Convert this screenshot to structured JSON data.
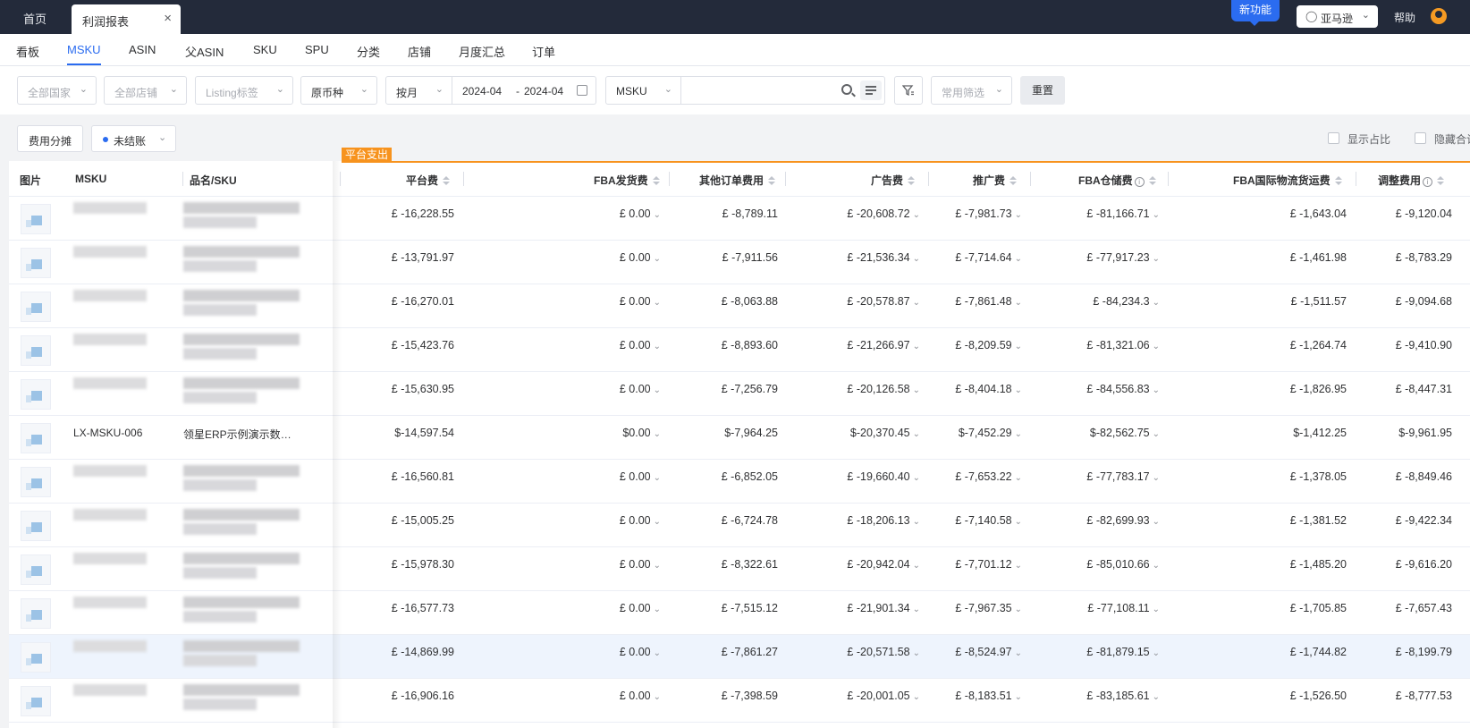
{
  "topbar": {
    "home_tab": "首页",
    "active_tab": "利润报表",
    "close_symbol": "×",
    "new_feature": "新功能",
    "marketplace": "亚马逊",
    "help": "帮助"
  },
  "subnav": {
    "items": [
      "看板",
      "MSKU",
      "ASIN",
      "父ASIN",
      "SKU",
      "SPU",
      "分类",
      "店铺",
      "月度汇总",
      "订单"
    ],
    "active": "MSKU"
  },
  "filters": {
    "country": "全部国家",
    "store": "全部店铺",
    "listing_tag": "Listing标签",
    "currency": "原币种",
    "period": "按月",
    "date_start": "2024-04",
    "date_sep": "-",
    "date_end": "2024-04",
    "search_field": "MSKU",
    "search_value": "",
    "common_filter": "常用筛选",
    "reset": "重置"
  },
  "toolbar": {
    "fee_allocation": "费用分摊",
    "status": "未结账",
    "show_ratio": "显示占比",
    "hide_total": "隐藏合计"
  },
  "table": {
    "group_label": "平台支出",
    "columns": {
      "image": "图片",
      "msku": "MSKU",
      "name_sku": "品名/SKU",
      "platform_fee": "平台费",
      "fba_fee": "FBA发货费",
      "other_order_fee": "其他订单费用",
      "ad_fee": "广告费",
      "promo_fee": "推广费",
      "fba_storage": "FBA仓储费",
      "fba_intl": "FBA国际物流货运费",
      "adjustment": "调整费用"
    },
    "rows": [
      {
        "msku": "",
        "name": "",
        "platform": "£ -16,228.55",
        "fba": "£ 0.00",
        "other": "£ -8,789.11",
        "ad": "£ -20,608.72",
        "promo": "£ -7,981.73",
        "storage": "£ -81,166.71",
        "intl": "£ -1,643.04",
        "adjust": "£ -9,120.04"
      },
      {
        "msku": "",
        "name": "",
        "platform": "£ -13,791.97",
        "fba": "£ 0.00",
        "other": "£ -7,911.56",
        "ad": "£ -21,536.34",
        "promo": "£ -7,714.64",
        "storage": "£ -77,917.23",
        "intl": "£ -1,461.98",
        "adjust": "£ -8,783.29"
      },
      {
        "msku": "",
        "name": "",
        "platform": "£ -16,270.01",
        "fba": "£ 0.00",
        "other": "£ -8,063.88",
        "ad": "£ -20,578.87",
        "promo": "£ -7,861.48",
        "storage": "£ -84,234.3",
        "intl": "£ -1,511.57",
        "adjust": "£ -9,094.68"
      },
      {
        "msku": "",
        "name": "",
        "platform": "£ -15,423.76",
        "fba": "£ 0.00",
        "other": "£ -8,893.60",
        "ad": "£ -21,266.97",
        "promo": "£ -8,209.59",
        "storage": "£ -81,321.06",
        "intl": "£ -1,264.74",
        "adjust": "£ -9,410.90"
      },
      {
        "msku": "",
        "name": "",
        "platform": "£ -15,630.95",
        "fba": "£ 0.00",
        "other": "£ -7,256.79",
        "ad": "£ -20,126.58",
        "promo": "£ -8,404.18",
        "storage": "£ -84,556.83",
        "intl": "£ -1,826.95",
        "adjust": "£ -8,447.31"
      },
      {
        "msku": "LX-MSKU-006",
        "name": "领星ERP示例演示数据...",
        "platform": "$-14,597.54",
        "fba": "$0.00",
        "other": "$-7,964.25",
        "ad": "$-20,370.45",
        "promo": "$-7,452.29",
        "storage": "$-82,562.75",
        "intl": "$-1,412.25",
        "adjust": "$-9,961.95"
      },
      {
        "msku": "",
        "name": "",
        "platform": "£ -16,560.81",
        "fba": "£ 0.00",
        "other": "£ -6,852.05",
        "ad": "£ -19,660.40",
        "promo": "£ -7,653.22",
        "storage": "£ -77,783.17",
        "intl": "£ -1,378.05",
        "adjust": "£ -8,849.46"
      },
      {
        "msku": "",
        "name": "",
        "platform": "£ -15,005.25",
        "fba": "£ 0.00",
        "other": "£ -6,724.78",
        "ad": "£ -18,206.13",
        "promo": "£ -7,140.58",
        "storage": "£ -82,699.93",
        "intl": "£ -1,381.52",
        "adjust": "£ -9,422.34"
      },
      {
        "msku": "",
        "name": "",
        "platform": "£ -15,978.30",
        "fba": "£ 0.00",
        "other": "£ -8,322.61",
        "ad": "£ -20,942.04",
        "promo": "£ -7,701.12",
        "storage": "£ -85,010.66",
        "intl": "£ -1,485.20",
        "adjust": "£ -9,616.20"
      },
      {
        "msku": "",
        "name": "",
        "platform": "£ -16,577.73",
        "fba": "£ 0.00",
        "other": "£ -7,515.12",
        "ad": "£ -21,901.34",
        "promo": "£ -7,967.35",
        "storage": "£ -77,108.11",
        "intl": "£ -1,705.85",
        "adjust": "£ -7,657.43"
      },
      {
        "msku": "",
        "name": "",
        "platform": "£ -14,869.99",
        "fba": "£ 0.00",
        "other": "£ -7,861.27",
        "ad": "£ -20,571.58",
        "promo": "£ -8,524.97",
        "storage": "£ -81,879.15",
        "intl": "£ -1,744.82",
        "adjust": "£ -8,199.79"
      },
      {
        "msku": "",
        "name": "",
        "platform": "£ -16,906.16",
        "fba": "£ 0.00",
        "other": "£ -7,398.59",
        "ad": "£ -20,001.05",
        "promo": "£ -8,183.51",
        "storage": "£ -83,185.61",
        "intl": "£ -1,526.50",
        "adjust": "£ -8,777.53"
      }
    ]
  },
  "colors": {
    "topbar": "#232a3a",
    "accent": "#2b6cf0",
    "group_orange": "#f7931e",
    "highlight_row": "#eef4fd"
  }
}
